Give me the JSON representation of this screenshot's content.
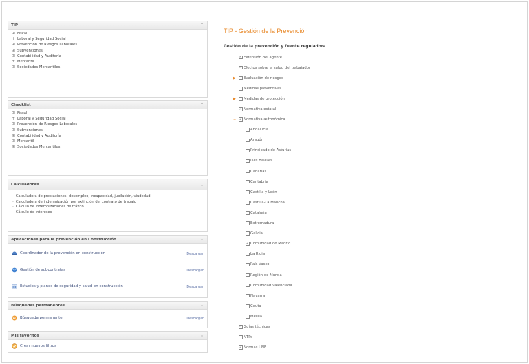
{
  "page": {
    "title": "TIP - Gestión de la Prevención"
  },
  "panels": [
    {
      "title": "TIP",
      "items": [
        {
          "exp": "⊞",
          "label": "Fiscal"
        },
        {
          "exp": "+",
          "label": "Laboral y Seguridad Social"
        },
        {
          "exp": "⊞",
          "label": "Prevención de Riesgos Laborales"
        },
        {
          "exp": "⊞",
          "label": "Subvenciones"
        },
        {
          "exp": "⊞",
          "label": "Contabilidad y Auditoría"
        },
        {
          "exp": "+",
          "label": "Mercantil"
        },
        {
          "exp": "⊞",
          "label": "Sociedades Mercantiles"
        }
      ]
    },
    {
      "title": "Checklist",
      "items": [
        {
          "exp": "⊞",
          "label": "Fiscal"
        },
        {
          "exp": "+",
          "label": "Laboral y Seguridad Social"
        },
        {
          "exp": "⊞",
          "label": "Prevención de Riesgos Laborales"
        },
        {
          "exp": "⊞",
          "label": "Subvenciones"
        },
        {
          "exp": "⊞",
          "label": "Contabilidad y Auditoría"
        },
        {
          "exp": "⊞",
          "label": "Mercantil"
        },
        {
          "exp": "⊞",
          "label": "Sociedades Mercantiles"
        }
      ]
    }
  ],
  "calculators": {
    "title": "Calculadoras",
    "items": [
      "Calculadora de prestaciones: desempleo, incapacidad, jubilación, viudedad",
      "Calculadora de indemnización por extinción del contrato de trabajo",
      "Cálculo de indemnizaciones de tráfico",
      "Cálculo de intereses"
    ]
  },
  "apps": {
    "title": "Aplicaciones para la prevención en Construcción",
    "items": [
      {
        "label": "Coordinador de la prevención en construcción",
        "download": "Descargar",
        "icon": "hard-hat-icon"
      },
      {
        "label": "Gestión de subcontratas",
        "download": "Descargar",
        "icon": "globe-icon"
      },
      {
        "label": "Estudios y planes de seguridad y salud en construcción",
        "download": "Descargar",
        "icon": "document-chart-icon"
      }
    ]
  },
  "searches": {
    "title": "Búsquedas permanentes",
    "items": [
      {
        "label": "Búsqueda permanente",
        "download": "Descargar",
        "icon": "search-orange-icon"
      }
    ]
  },
  "favorites": {
    "title": "Mis favoritos",
    "link": "Crear nuevos filtros",
    "icon": "star-icon"
  },
  "main": {
    "section_title": "Gestión de la prevención y fuente reguladora",
    "rows": [
      {
        "indent": 0,
        "label": "Extensión del agente",
        "checked": true
      },
      {
        "indent": 0,
        "label": "Efectos sobre la salud del trabajador",
        "checked": true
      },
      {
        "indent": 0,
        "label": "Evaluación de riesgos",
        "checked": false,
        "marker": "▶"
      },
      {
        "indent": 0,
        "label": "Medidas preventivas",
        "checked": false
      },
      {
        "indent": 0,
        "label": "Medidas de protección",
        "checked": false,
        "marker": "▶"
      },
      {
        "indent": 0,
        "label": "Normativa estatal",
        "checked": true
      },
      {
        "indent": 0,
        "label": "Normativa autonómica",
        "checked": true,
        "marker": "−"
      },
      {
        "indent": 1,
        "label": "Andalucía",
        "checked": false
      },
      {
        "indent": 1,
        "label": "Aragón",
        "checked": false
      },
      {
        "indent": 1,
        "label": "Principado de Asturias",
        "checked": false
      },
      {
        "indent": 1,
        "label": "Illes Balears",
        "checked": false
      },
      {
        "indent": 1,
        "label": "Canarias",
        "checked": false
      },
      {
        "indent": 1,
        "label": "Cantabria",
        "checked": false
      },
      {
        "indent": 1,
        "label": "Castilla y León",
        "checked": false
      },
      {
        "indent": 1,
        "label": "Castilla-La Mancha",
        "checked": false
      },
      {
        "indent": 1,
        "label": "Cataluña",
        "checked": false
      },
      {
        "indent": 1,
        "label": "Extremadura",
        "checked": false
      },
      {
        "indent": 1,
        "label": "Galicia",
        "checked": false
      },
      {
        "indent": 1,
        "label": "Comunidad de Madrid",
        "checked": true
      },
      {
        "indent": 1,
        "label": "La Rioja",
        "checked": false
      },
      {
        "indent": 1,
        "label": "País Vasco",
        "checked": false
      },
      {
        "indent": 1,
        "label": "Región de Murcia",
        "checked": false
      },
      {
        "indent": 1,
        "label": "Comunidad Valenciana",
        "checked": false
      },
      {
        "indent": 1,
        "label": "Navarra",
        "checked": false
      },
      {
        "indent": 1,
        "label": "Ceuta",
        "checked": false
      },
      {
        "indent": 1,
        "label": "Melilla",
        "checked": false
      },
      {
        "indent": 0,
        "label": "Guías técnicas",
        "checked": true
      },
      {
        "indent": 0,
        "label": "NTPs",
        "checked": false
      },
      {
        "indent": 0,
        "label": "Normas UNE",
        "checked": true
      }
    ]
  }
}
